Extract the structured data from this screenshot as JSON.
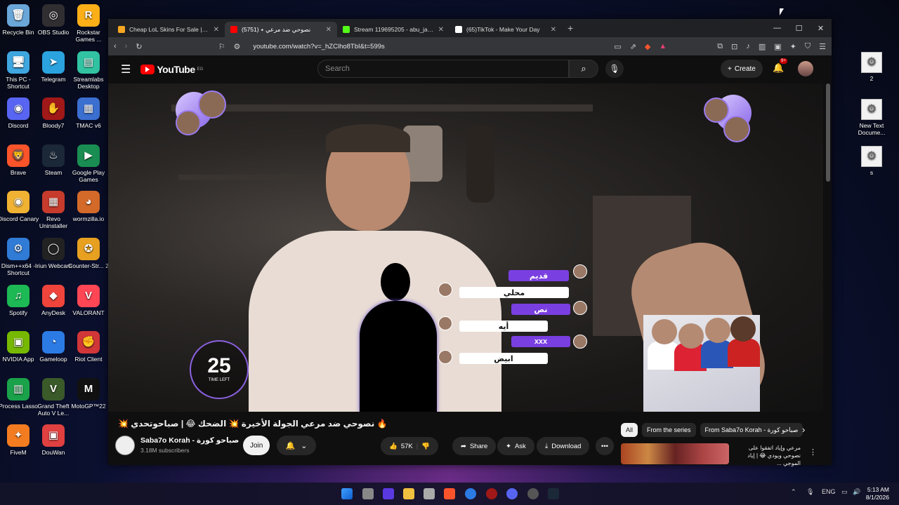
{
  "desktop": {
    "icons_left": [
      {
        "label": "Recycle Bin",
        "color": "#6aa6d8",
        "glyph": "🗑"
      },
      {
        "label": "This PC - Shortcut",
        "color": "#3fa7e0",
        "glyph": "🖥"
      },
      {
        "label": "Discord",
        "color": "#5865f2",
        "glyph": "◉"
      },
      {
        "label": "Brave",
        "color": "#fb542b",
        "glyph": "🦁"
      },
      {
        "label": "Discord Canary",
        "color": "#f0b232",
        "glyph": "◉"
      },
      {
        "label": "Dism++x64 - Shortcut",
        "color": "#2f7bd6",
        "glyph": "⚙"
      },
      {
        "label": "Spotify",
        "color": "#1db954",
        "glyph": "♫"
      },
      {
        "label": "NVIDIA App",
        "color": "#76b900",
        "glyph": "▣"
      },
      {
        "label": "Process Lasso",
        "color": "#1aa24a",
        "glyph": "▥"
      },
      {
        "label": "FiveM",
        "color": "#f47c20",
        "glyph": "✦"
      }
    ],
    "icons_mid": [
      {
        "label": "OBS Studio",
        "color": "#302e31",
        "glyph": "◎"
      },
      {
        "label": "Telegram",
        "color": "#2aa3df",
        "glyph": "➤"
      },
      {
        "label": "Bloody7",
        "color": "#a01818",
        "glyph": "✋"
      },
      {
        "label": "Steam",
        "color": "#1b2838",
        "glyph": "♨"
      },
      {
        "label": "Revo Uninstaller",
        "color": "#c63b2c",
        "glyph": "▦"
      },
      {
        "label": "Iriun Webcam",
        "color": "#222222",
        "glyph": "◯"
      },
      {
        "label": "AnyDesk",
        "color": "#ef443b",
        "glyph": "◆"
      },
      {
        "label": "Gameloop",
        "color": "#2c7be5",
        "glyph": "◔"
      },
      {
        "label": "Grand Theft Auto V Le...",
        "color": "#3a5a2a",
        "glyph": "V"
      },
      {
        "label": "DouWan",
        "color": "#e04040",
        "glyph": "▣"
      }
    ],
    "icons_right": [
      {
        "label": "Rockstar Games ...",
        "color": "#fcaf17",
        "glyph": "R"
      },
      {
        "label": "Streamlabs Desktop",
        "color": "#31c3a2",
        "glyph": "▤"
      },
      {
        "label": "TMAC v6",
        "color": "#3b6fd0",
        "glyph": "▦"
      },
      {
        "label": "Google Play Games",
        "color": "#1a8e52",
        "glyph": "▶"
      },
      {
        "label": "wormzilla.io",
        "color": "#d46a2a",
        "glyph": "◕"
      },
      {
        "label": "Counter-Str... 2",
        "color": "#e8a020",
        "glyph": "✪"
      },
      {
        "label": "VALORANT",
        "color": "#ff4655",
        "glyph": "V"
      },
      {
        "label": "Riot Client",
        "color": "#d13639",
        "glyph": "✊"
      },
      {
        "label": "MotoGP™22",
        "color": "#111111",
        "glyph": "M"
      }
    ],
    "files_right": [
      {
        "label": "2"
      },
      {
        "label": "New Text Docume..."
      },
      {
        "label": "s"
      }
    ]
  },
  "browser": {
    "tabs": [
      {
        "title": "Cheap LoL Skins For Sale | Buy Le",
        "favicon_color": "#f5a623",
        "active": false
      },
      {
        "title": "نصوحي ضد مرعي ٭ (5751)",
        "favicon_color": "#ff0000",
        "active": true
      },
      {
        "title": "Stream 119695205 - abu_jaradeh - K",
        "favicon_color": "#53fc18",
        "active": false
      },
      {
        "title": "(65)TikTok - Make Your Day",
        "favicon_color": "#ffffff",
        "active": false
      }
    ],
    "url": "youtube.com/watch?v=_hZClho8TbI&t=599s"
  },
  "youtube": {
    "logo_text": "YouTube",
    "region": "EG",
    "search_placeholder": "Search",
    "create_label": "Create",
    "notif_count": "9+",
    "video": {
      "answers": [
        {
          "text": "قديم",
          "style": "p"
        },
        {
          "text": "محلي",
          "style": "w"
        },
        {
          "text": "نص",
          "style": "p"
        },
        {
          "text": "أيه",
          "style": "w"
        },
        {
          "text": "xxx",
          "style": "p"
        },
        {
          "text": "ابيض",
          "style": "w"
        }
      ],
      "timer_value": "25",
      "timer_label": "TIME LEFT"
    },
    "title": "🔥 نصوحي ضد مرعي الجولة الأخيرة 💥 الضحك 😂 | صباحوتحدي 💥",
    "channel": {
      "name": "Saba7o Korah - صباحو كورة",
      "subscribers": "3.18M subscribers",
      "join_label": "Join"
    },
    "actions": {
      "likes": "57K",
      "share": "Share",
      "ask": "Ask",
      "download": "Download"
    },
    "chips": [
      "All",
      "From the series",
      "From Saba7o Korah - صباحو كورة"
    ],
    "recommended_title": "مرعي وإياد اتفقوا على نصوحي ويودي 😂 | إياد الموجي ..."
  },
  "taskbar": {
    "lang": "ENG",
    "time": "5:13 AM",
    "date": "8/1/2026"
  }
}
